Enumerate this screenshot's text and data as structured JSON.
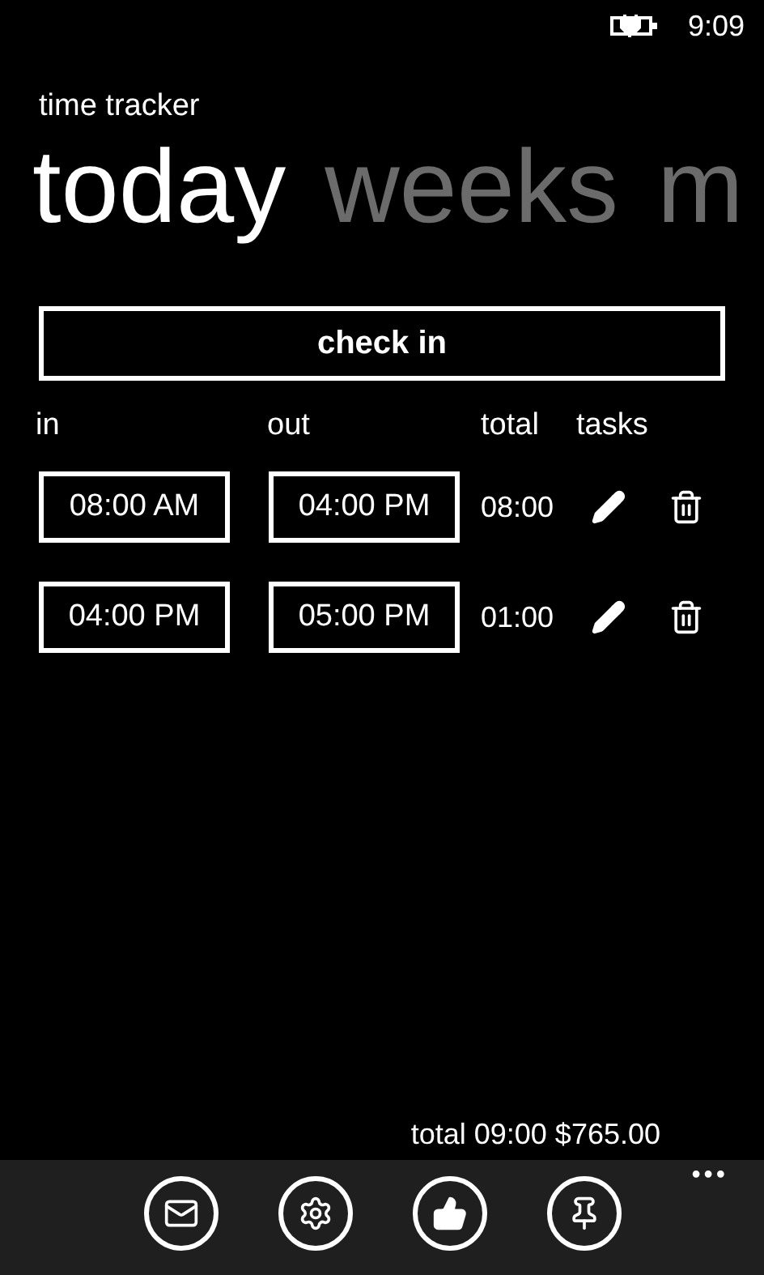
{
  "status_bar": {
    "time": "9:09"
  },
  "app_title": "time tracker",
  "pivot": [
    {
      "label": "today",
      "selected": true
    },
    {
      "label": "weeks",
      "selected": false
    },
    {
      "label": "m",
      "selected": false
    }
  ],
  "check_in_button": "check in",
  "columns": [
    "in",
    "out",
    "total",
    "tasks"
  ],
  "entries": [
    {
      "in": "08:00 AM",
      "out": "04:00 PM",
      "total": "08:00"
    },
    {
      "in": "04:00 PM",
      "out": "05:00 PM",
      "total": "01:00"
    }
  ],
  "summary": "total 09:00 $765.00",
  "app_bar": {
    "buttons": [
      {
        "kind": "mail"
      },
      {
        "kind": "settings"
      },
      {
        "kind": "like"
      },
      {
        "kind": "pin"
      }
    ],
    "more": "•••"
  }
}
